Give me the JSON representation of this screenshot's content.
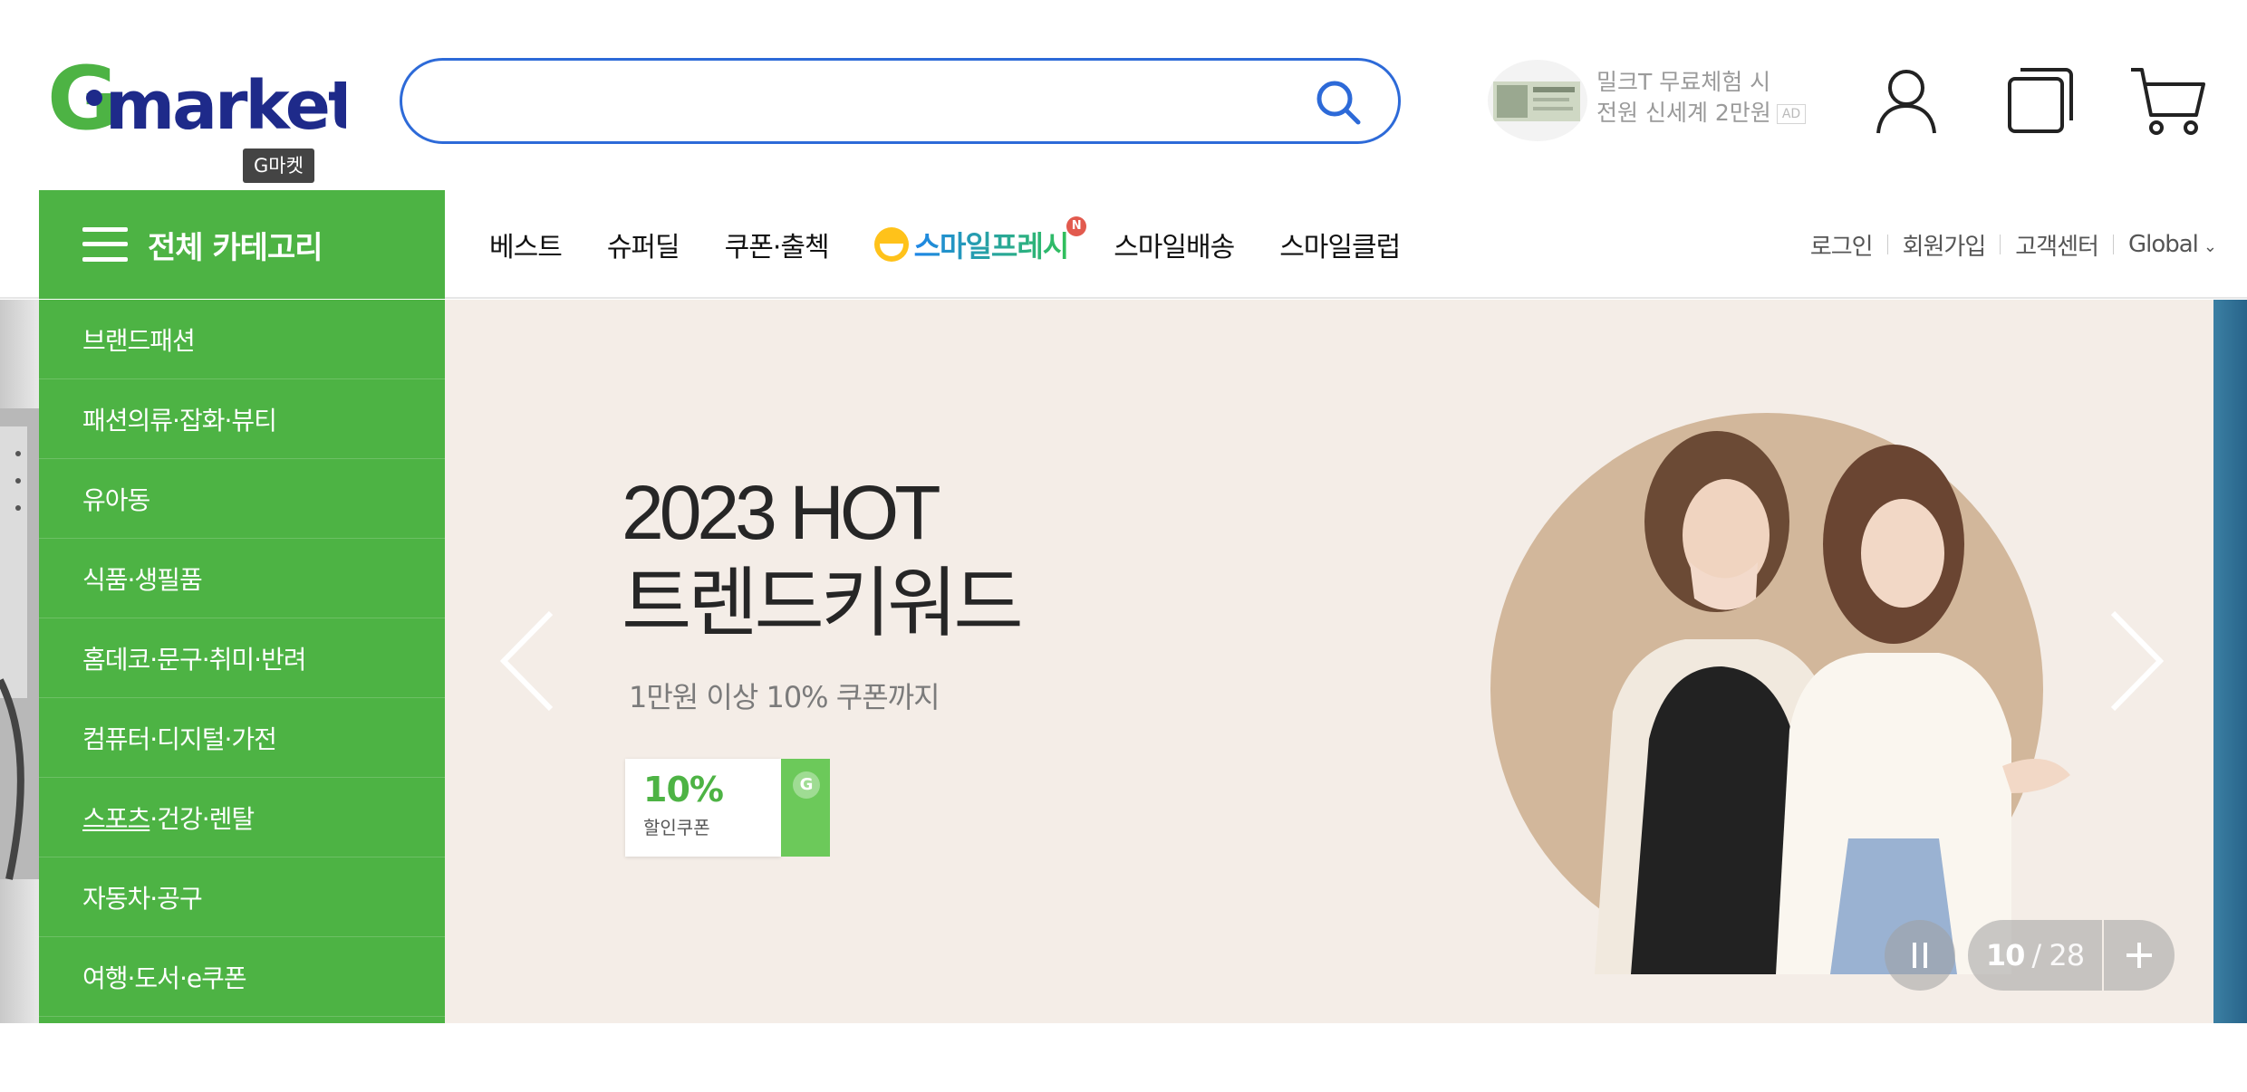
{
  "header": {
    "logo_text": "Gmarket",
    "logo_tooltip": "G마켓",
    "search": {
      "value": "",
      "placeholder": ""
    },
    "ad": {
      "line1": "밀크T 무료체험 시",
      "line2": "전원 신세계 2만원",
      "badge": "AD"
    }
  },
  "nav": {
    "all_category": "전체 카테고리",
    "links": [
      "베스트",
      "슈퍼딜",
      "쿠폰·출첵"
    ],
    "smile_fresh": "스마일프레시",
    "smile_badge": "N",
    "links2": [
      "스마일배송",
      "스마일클럽"
    ],
    "util": [
      "로그인",
      "회원가입",
      "고객센터",
      "Global"
    ]
  },
  "categories": [
    "브랜드패션",
    "패션의류·잡화·뷰티",
    "유아동",
    "식품·생필품",
    "홈데코·문구·취미·반려",
    "컴퓨터·디지털·가전",
    "스포츠·건강·렌탈",
    "자동차·공구",
    "여행·도서·e쿠폰"
  ],
  "banner": {
    "title1": "2023 HOT",
    "title2": "트렌드키워드",
    "subtitle": "1만원 이상 10% 쿠폰까지",
    "coupon_pct": "10%",
    "coupon_label": "할인쿠폰",
    "coupon_mark": "G",
    "current": "10",
    "total": "/ 28"
  },
  "colors": {
    "brand_green": "#4db344",
    "brand_blue": "#2d6ad8",
    "slide_bg": "#f4ede7"
  }
}
